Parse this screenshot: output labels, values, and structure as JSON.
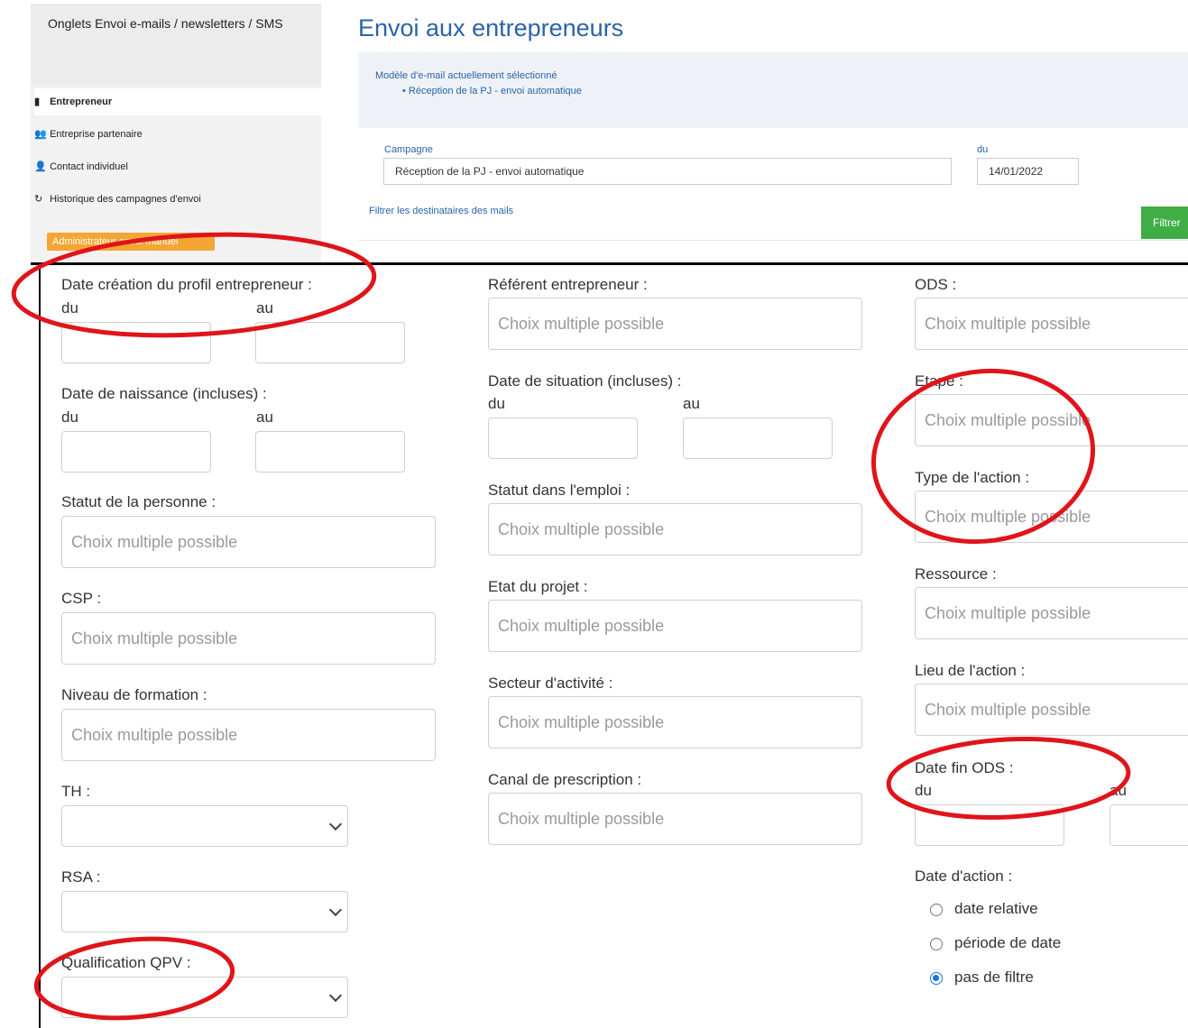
{
  "sidebar": {
    "header": "Onglets Envoi e-mails / newsletters / SMS",
    "items": [
      {
        "icon": "▮",
        "label": "Entrepreneur"
      },
      {
        "icon": "👥",
        "label": "Entreprise partenaire"
      },
      {
        "icon": "👤",
        "label": "Contact individuel"
      },
      {
        "icon": "↻",
        "label": "Historique des campagnes d'envoi"
      }
    ],
    "manual_button": "Administrateur envoi manuel"
  },
  "header": {
    "title": "Envoi aux entrepreneurs",
    "model_label": "Modèle d'e-mail actuellement sélectionné",
    "model_value": "• Réception de la PJ - envoi automatique"
  },
  "campaign": {
    "label": "Campagne",
    "value": "Réception de la PJ - envoi automatique",
    "date_label": "du",
    "date_value": "14/01/2022",
    "filter_link": "Filtrer les destinataires des mails",
    "filter_button": "Filtrer"
  },
  "form": {
    "placeholder": "Choix multiple possible",
    "from": "du",
    "to": "au",
    "col1": {
      "date_creation": "Date création du profil entrepreneur :",
      "date_naissance": "Date de naissance (incluses) :",
      "statut_personne": "Statut de la personne :",
      "csp": "CSP :",
      "niveau_formation": "Niveau de formation :",
      "th": "TH :",
      "rsa": "RSA :",
      "qpv": "Qualification QPV :"
    },
    "col2": {
      "referent": "Référent entrepreneur :",
      "date_situation": "Date de situation (incluses) :",
      "statut_emploi": "Statut dans l'emploi :",
      "etat_projet": "Etat du projet :",
      "secteur": "Secteur d'activité :",
      "canal": "Canal de prescription :"
    },
    "col3": {
      "ods": "ODS :",
      "etape": "Etape :",
      "type_action": "Type de l'action :",
      "ressource": "Ressource :",
      "lieu_action": "Lieu de l'action :",
      "date_fin_ods": "Date fin ODS :",
      "date_action": "Date d'action :",
      "radio_options": [
        "date relative",
        "période de date",
        "pas de filtre"
      ],
      "radio_selected": "pas de filtre"
    }
  },
  "colors": {
    "title_blue": "#2b63a8",
    "annotation_red": "#e0141b",
    "radio_blue": "#1a73e8",
    "orange": "#f4a634",
    "green": "#3fae45"
  }
}
